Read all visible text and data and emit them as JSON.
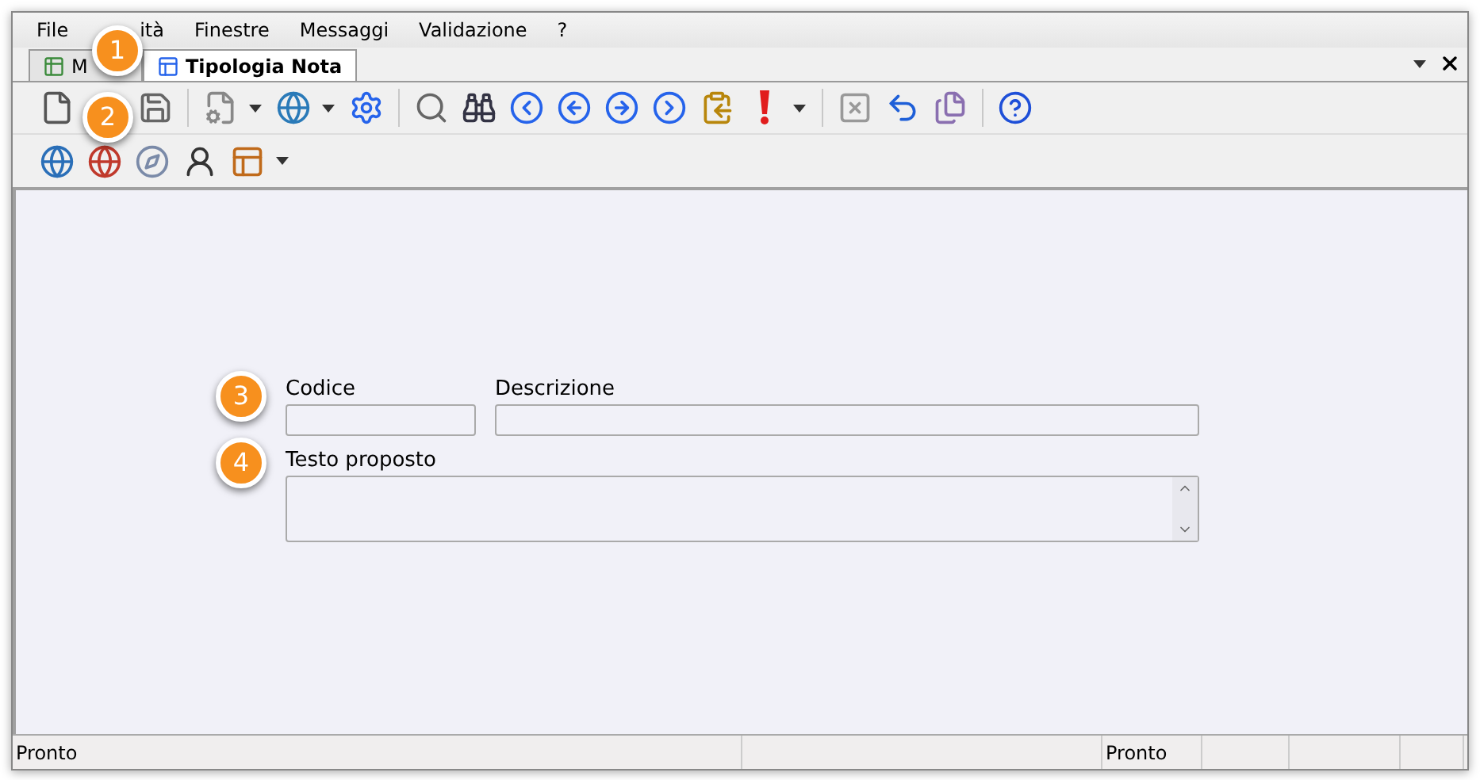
{
  "menu": [
    {
      "label": "File"
    },
    {
      "label": "ità"
    },
    {
      "label": "Finestre"
    },
    {
      "label": "Messaggi"
    },
    {
      "label": "Validazione"
    },
    {
      "label": "?"
    }
  ],
  "tabs": [
    {
      "label": "M",
      "selected": false
    },
    {
      "label": "Tipologia Nota",
      "selected": true
    }
  ],
  "form": {
    "code_label": "Codice",
    "description_label": "Descrizione",
    "text_label": "Testo proposto"
  },
  "status_bar": {
    "left": "Pronto",
    "right": "Pronto"
  },
  "callouts": [
    {
      "label": "1"
    },
    {
      "label": "2"
    },
    {
      "label": "3"
    },
    {
      "label": "4"
    }
  ]
}
